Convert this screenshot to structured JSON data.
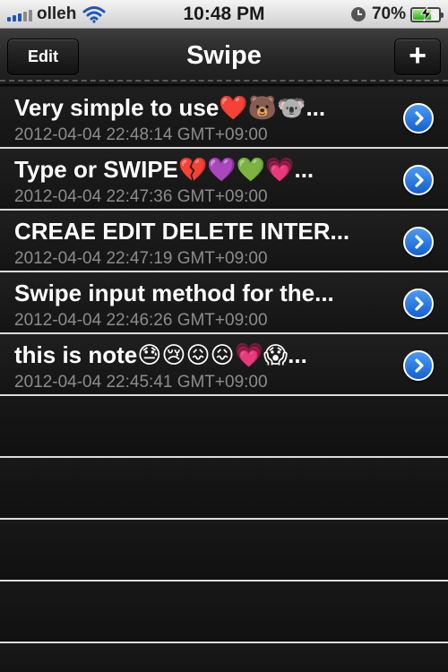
{
  "status_bar": {
    "carrier": "olleh",
    "time": "10:48 PM",
    "battery_percent": "70%",
    "battery_level": 0.7,
    "icons": [
      "signal-icon",
      "wifi-icon",
      "clock-icon",
      "battery-icon",
      "charging-icon"
    ]
  },
  "nav": {
    "title": "Swipe",
    "edit_label": "Edit",
    "add_label": "+"
  },
  "notes": [
    {
      "title": "Very simple to use❤️🐻🐨...",
      "date": "2012-04-04 22:48:14 GMT+09:00"
    },
    {
      "title": "Type or SWIPE💔💜💚💗...",
      "date": "2012-04-04 22:47:36 GMT+09:00"
    },
    {
      "title": "CREAE EDIT DELETE INTER...",
      "date": "2012-04-04 22:47:19 GMT+09:00"
    },
    {
      "title": "Swipe input method for the...",
      "date": "2012-04-04 22:46:26 GMT+09:00"
    },
    {
      "title": "this is note😓😢😖😖💗😱...",
      "date": "2012-04-04 22:45:41 GMT+09:00"
    }
  ],
  "colors": {
    "accent": "#1f6fd8",
    "background": "#141414",
    "separator": "#dcdcdc",
    "subtitle": "#8c8c8c"
  }
}
